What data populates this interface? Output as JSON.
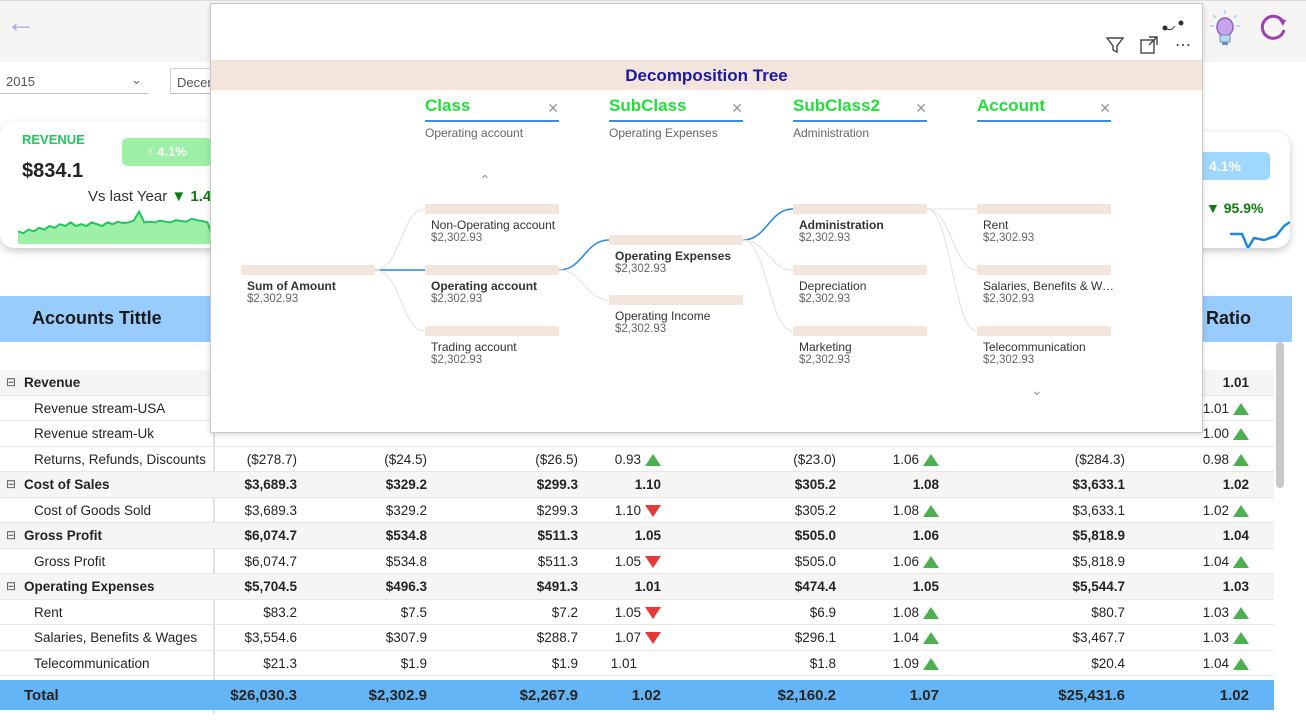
{
  "header": {
    "back_icon": "back-arrow-icon",
    "bulb_icon": "lightbulb-icon",
    "refresh_icon": "refresh-icon"
  },
  "slicers": {
    "year": "2015",
    "month": "Decem"
  },
  "revenue_card": {
    "label": "REVENUE",
    "value": "$834.1",
    "badge": "↑ 4.1%",
    "vs_label": "Vs last Year",
    "vs_value": "1.4",
    "sparkline": [
      0.35,
      0.3,
      0.4,
      0.35,
      0.45,
      0.4,
      0.5,
      0.45,
      0.55,
      0.5,
      0.6,
      0.5,
      0.55,
      0.5,
      0.6,
      0.55,
      0.5,
      0.6,
      0.55,
      0.62,
      0.58,
      0.6,
      0.65,
      0.9,
      0.6,
      0.62,
      0.6,
      0.65,
      0.62,
      0.6,
      0.66,
      0.64,
      0.62,
      0.7,
      0.66,
      0.64,
      0.6,
      0.2,
      0.5
    ]
  },
  "right_card": {
    "badge": "4.1%",
    "pct": "95.9%"
  },
  "matrix": {
    "title": "Accounts Tittle",
    "ratio_header": "Ratio",
    "rows": [
      {
        "group": true,
        "name": "Revenue",
        "c8": "1.01"
      },
      {
        "group": false,
        "name": "Revenue stream-USA",
        "c8": "1.01",
        "i8": "up"
      },
      {
        "group": false,
        "name": "Revenue stream-Uk",
        "c8": "1.00",
        "i8": "up"
      },
      {
        "group": false,
        "name": "Returns, Refunds, Discounts",
        "c1": "($278.7)",
        "c2": "($24.5)",
        "c3": "($26.5)",
        "c4": "0.93",
        "i4": "up",
        "c5": "($23.0)",
        "c6": "1.06",
        "i6": "up",
        "c7": "($284.3)",
        "c8": "0.98",
        "i8": "up"
      },
      {
        "group": true,
        "name": "Cost of Sales",
        "c1": "$3,689.3",
        "c2": "$329.2",
        "c3": "$299.3",
        "c4": "1.10",
        "c5": "$305.2",
        "c6": "1.08",
        "c7": "$3,633.1",
        "c8": "1.02"
      },
      {
        "group": false,
        "name": "Cost of Goods Sold",
        "c1": "$3,689.3",
        "c2": "$329.2",
        "c3": "$299.3",
        "c4": "1.10",
        "i4": "dn",
        "c5": "$305.2",
        "c6": "1.08",
        "i6": "up",
        "c7": "$3,633.1",
        "c8": "1.02",
        "i8": "up"
      },
      {
        "group": true,
        "name": "Gross Profit",
        "c1": "$6,074.7",
        "c2": "$534.8",
        "c3": "$511.3",
        "c4": "1.05",
        "c5": "$505.0",
        "c6": "1.06",
        "c7": "$5,818.9",
        "c8": "1.04"
      },
      {
        "group": false,
        "name": "Gross Profit",
        "c1": "$6,074.7",
        "c2": "$534.8",
        "c3": "$511.3",
        "c4": "1.05",
        "i4": "dn",
        "c5": "$505.0",
        "c6": "1.06",
        "i6": "up",
        "c7": "$5,818.9",
        "c8": "1.04",
        "i8": "up"
      },
      {
        "group": true,
        "name": "Operating Expenses",
        "c1": "$5,704.5",
        "c2": "$496.3",
        "c3": "$491.3",
        "c4": "1.01",
        "c5": "$474.4",
        "c6": "1.05",
        "c7": "$5,544.7",
        "c8": "1.03"
      },
      {
        "group": false,
        "name": "Rent",
        "c1": "$83.2",
        "c2": "$7.5",
        "c3": "$7.2",
        "c4": "1.05",
        "i4": "dn",
        "c5": "$6.9",
        "c6": "1.08",
        "i6": "up",
        "c7": "$80.7",
        "c8": "1.03",
        "i8": "up"
      },
      {
        "group": false,
        "name": "Salaries, Benefits & Wages",
        "c1": "$3,554.6",
        "c2": "$307.9",
        "c3": "$288.7",
        "c4": "1.07",
        "i4": "dn",
        "c5": "$296.1",
        "c6": "1.04",
        "i6": "up",
        "c7": "$3,467.7",
        "c8": "1.03",
        "i8": "up"
      },
      {
        "group": false,
        "name": "Telecommunication",
        "c1": "$21.3",
        "c2": "$1.9",
        "c3": "$1.9",
        "c4": "1.01",
        "i4": "sp",
        "c5": "$1.8",
        "c6": "1.09",
        "i6": "up",
        "c7": "$20.4",
        "c8": "1.04",
        "i8": "up"
      }
    ],
    "total": {
      "name": "Total",
      "c1": "$26,030.3",
      "c2": "$2,302.9",
      "c3": "$2,267.9",
      "c4": "1.02",
      "c5": "$2,160.2",
      "c6": "1.07",
      "c7": "$25,431.6",
      "c8": "1.02"
    }
  },
  "decomp": {
    "title": "Decomposition Tree",
    "toolbar": {
      "filter_icon": "filter-icon",
      "focus_icon": "focus-mode-icon",
      "more_icon": "more-options-icon"
    },
    "levels": [
      {
        "name": "Class",
        "selection": "Operating account"
      },
      {
        "name": "SubClass",
        "selection": "Operating Expenses"
      },
      {
        "name": "SubClass2",
        "selection": "Administration"
      },
      {
        "name": "Account",
        "selection": ""
      }
    ],
    "root": {
      "label": "Sum of Amount",
      "value": "$2,302.93"
    },
    "col1": [
      {
        "label": "Non-Operating account",
        "value": "$2,302.93"
      },
      {
        "label": "Operating account",
        "value": "$2,302.93",
        "selected": true
      },
      {
        "label": "Trading account",
        "value": "$2,302.93"
      }
    ],
    "col2": [
      {
        "label": "Operating Expenses",
        "value": "$2,302.93",
        "selected": true
      },
      {
        "label": "Operating Income",
        "value": "$2,302.93"
      }
    ],
    "col3": [
      {
        "label": "Administration",
        "value": "$2,302.93",
        "selected": true
      },
      {
        "label": "Depreciation",
        "value": "$2,302.93"
      },
      {
        "label": "Marketing",
        "value": "$2,302.93"
      }
    ],
    "col4": [
      {
        "label": "Rent",
        "value": "$2,302.93"
      },
      {
        "label": "Salaries, Benefits & Wa...",
        "value": "$2,302.93"
      },
      {
        "label": "Telecommunication",
        "value": "$2,302.93"
      }
    ]
  }
}
